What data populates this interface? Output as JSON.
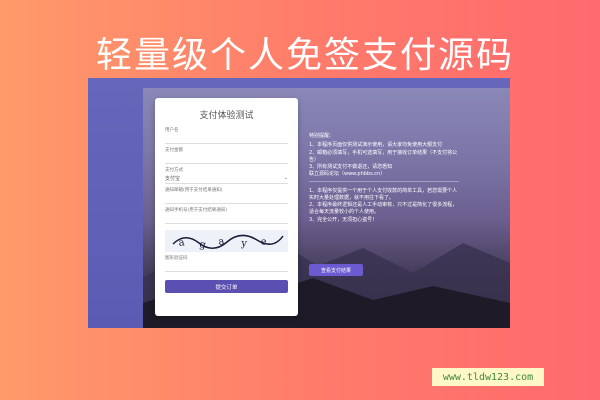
{
  "banner": {
    "title": "轻量级个人免签支付源码"
  },
  "form": {
    "title": "支付体验测试",
    "username_label": "用户名",
    "amount_label": "支付金额",
    "method_label": "支付方式",
    "method_value": "支付宝",
    "email_placeholder": "通知邮箱(用于支付结果通知)",
    "phone_placeholder": "通知手机号(用于支付结果通知)",
    "captcha_label": "图形验证码",
    "submit_label": "提交订单"
  },
  "notes": {
    "header": "特别提醒：",
    "lines": [
      "1、本程序页面仅供测试演示使用，请大家勿免使用大额支付",
      "2、邮箱必须填写，手机可选填写，用于接收订单结果（不支付将公告）",
      "3、所有测试支付不做退还，请您悉知",
      "联立源码论坛（www.phbbs.cn）"
    ],
    "lines2": [
      "1、本程序仅提供一个用于个人支付收款的简单工具，若您需要个人实时大量处理数据，就不用往下看了。",
      "2、本程序最终逻辑还是人工手动审核，只不过是简化了很多流程，适合每天流量较小的个人使用。",
      "3、完全公开，无须担心盗号！"
    ],
    "result_button": "查看支付结果"
  },
  "watermark": "www.tldw123.com"
}
